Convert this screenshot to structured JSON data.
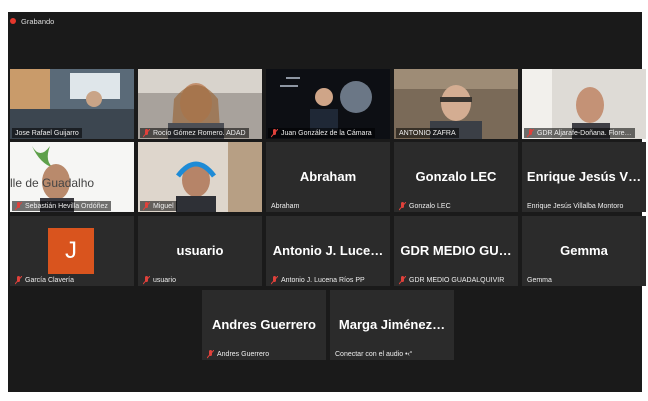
{
  "recording": {
    "label": "Grabando",
    "color": "#e5372c"
  },
  "accent": {
    "speaker_highlight": "#c7e23a",
    "muted_mic": "#e0413b"
  },
  "participants": [
    {
      "name": "Jose Rafael Guijarro",
      "muted": false
    },
    {
      "name": "Rocío Gómez Romero. ADAD",
      "muted": true
    },
    {
      "name": "Juan González de la Cámara",
      "muted": true
    },
    {
      "name": "ANTONIO ZAFRA",
      "muted": false,
      "active_speaker": true
    },
    {
      "name": "GDR Aljarafe-Doñana. Flore…",
      "muted": true
    },
    {
      "name": "Sebastián Hevilla Ordóñez",
      "muted": true,
      "video_text": "lle de Guadalho"
    },
    {
      "name": "Miguel",
      "muted": true
    },
    {
      "display": "Abraham",
      "name": "Abraham",
      "muted": false
    },
    {
      "display": "Gonzalo LEC",
      "name": "Gonzalo LEC",
      "muted": true
    },
    {
      "display": "Enrique Jesús V…",
      "name": "Enrique Jesús Villalba Montoro",
      "muted": false
    },
    {
      "initial": "J",
      "name": "García Clavería",
      "muted": true
    },
    {
      "display": "usuario",
      "name": "usuario",
      "muted": true
    },
    {
      "display": "Antonio J. Luce…",
      "name": "Antonio J. Lucena Ríos PP",
      "muted": true
    },
    {
      "display": "GDR MEDIO GU…",
      "name": "GDR MEDIO GUADALQUIVIR",
      "muted": true
    },
    {
      "display": "Gemma",
      "name": "Gemma",
      "muted": false
    },
    {
      "display": "Andres Guerrero",
      "name": "Andres Guerrero",
      "muted": true
    },
    {
      "display": "Marga Jiménez…",
      "name": "Conectar con el audio",
      "muted": false,
      "audio_wave": "•‹“"
    }
  ]
}
